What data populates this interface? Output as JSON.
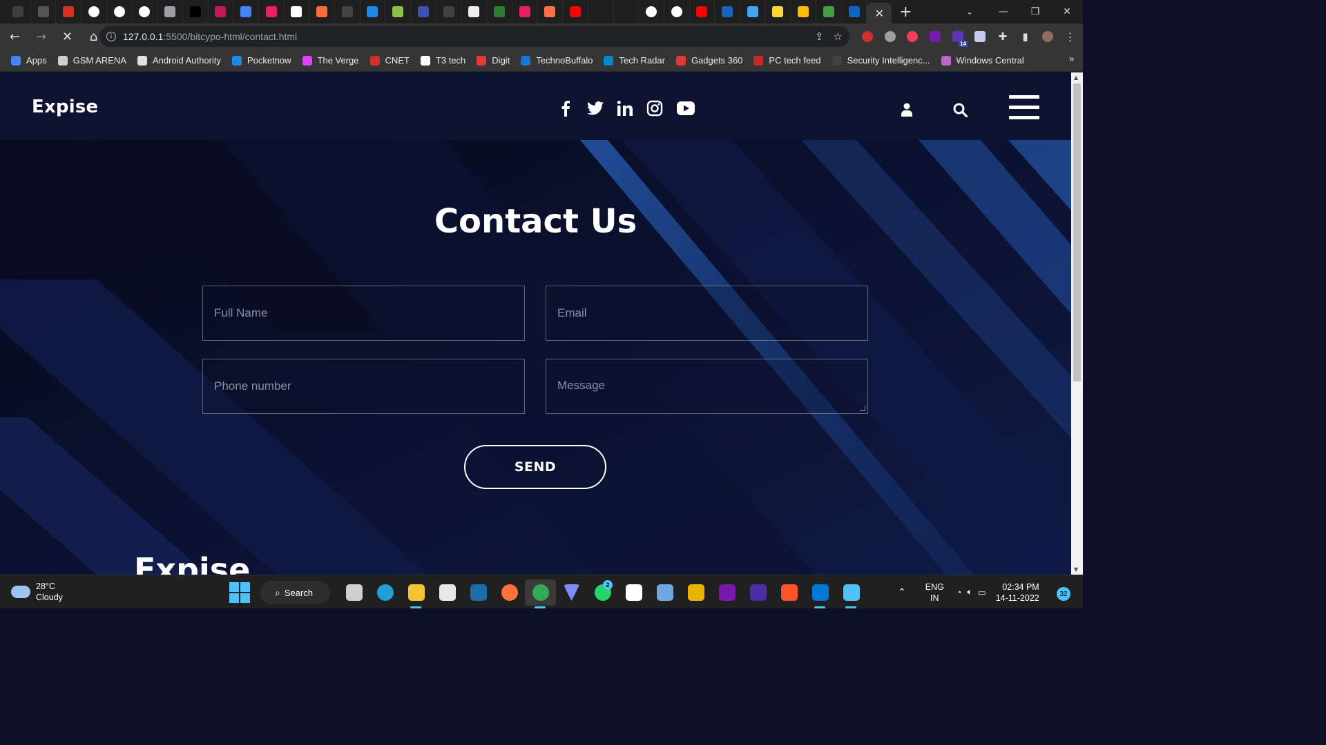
{
  "browser": {
    "tab_favicons": [
      {
        "name": "tab-1",
        "color": "#3c4043"
      },
      {
        "name": "tab-2",
        "color": "#555"
      },
      {
        "name": "gmail",
        "color": "#d93025"
      },
      {
        "name": "github",
        "color": "#ffffff"
      },
      {
        "name": "github",
        "color": "#ffffff"
      },
      {
        "name": "github",
        "color": "#ffffff"
      },
      {
        "name": "globe",
        "color": "#9aa0a6"
      },
      {
        "name": "medium",
        "color": "#000000"
      },
      {
        "name": "shield",
        "color": "#c2185b"
      },
      {
        "name": "map-pin",
        "color": "#4285f4"
      },
      {
        "name": "pattern",
        "color": "#e91e63"
      },
      {
        "name": "bolt",
        "color": "#ffffff"
      },
      {
        "name": "postman",
        "color": "#ff6c37"
      },
      {
        "name": "dot",
        "color": "#444"
      },
      {
        "name": "robot",
        "color": "#1e88e5"
      },
      {
        "name": "swirl",
        "color": "#8bc34a"
      },
      {
        "name": "sphere",
        "color": "#3f51b5"
      },
      {
        "name": "terminal",
        "color": "#424242"
      },
      {
        "name": "news",
        "color": "#eeeeee"
      },
      {
        "name": "j-logo",
        "color": "#2e7d32"
      },
      {
        "name": "pink-p",
        "color": "#e91e63"
      },
      {
        "name": "gradient",
        "color": "#ff7043"
      },
      {
        "name": "youtube",
        "color": "#ff0000"
      },
      {
        "name": "blank",
        "color": "#1f1f1f"
      },
      {
        "name": "blank-2",
        "color": "#1f1f1f"
      },
      {
        "name": "github",
        "color": "#ffffff"
      },
      {
        "name": "github",
        "color": "#ffffff"
      },
      {
        "name": "youtube",
        "color": "#ff0000"
      },
      {
        "name": "cloud",
        "color": "#1565c0"
      },
      {
        "name": "bars",
        "color": "#42a5f5"
      },
      {
        "name": "yellow-doc",
        "color": "#fdd835"
      },
      {
        "name": "drive",
        "color": "#fbbc04"
      },
      {
        "name": "green-shield",
        "color": "#43a047"
      },
      {
        "name": "linkedin",
        "color": "#0a66c2"
      }
    ],
    "address_host": "127.0.0.1",
    "address_path": ":5500/bitcypo-html/contact.html",
    "bookmarks": [
      {
        "label": "Apps",
        "color": "#4285f4"
      },
      {
        "label": "GSM ARENA",
        "color": "#d0d0d0"
      },
      {
        "label": "Android Authority",
        "color": "#e0e0e0"
      },
      {
        "label": "Pocketnow",
        "color": "#1e88e5"
      },
      {
        "label": "The Verge",
        "color": "#e040fb"
      },
      {
        "label": "CNET",
        "color": "#d32f2f"
      },
      {
        "label": "T3 tech",
        "color": "#ffffff"
      },
      {
        "label": "Digit",
        "color": "#e53935"
      },
      {
        "label": "TechnoBuffalo",
        "color": "#1976d2"
      },
      {
        "label": "Tech Radar",
        "color": "#0288d1"
      },
      {
        "label": "Gadgets 360",
        "color": "#e53935"
      },
      {
        "label": "PC tech feed",
        "color": "#c62828"
      },
      {
        "label": "Security Intelligenc...",
        "color": "#424242"
      },
      {
        "label": "Windows Central",
        "color": "#ba68c8"
      }
    ]
  },
  "site": {
    "logo": "Expise",
    "title": "Contact Us",
    "form": {
      "full_name_placeholder": "Full Name",
      "email_placeholder": "Email",
      "phone_placeholder": "Phone number",
      "message_placeholder": "Message",
      "send_label": "SEND"
    },
    "footer_brand": "Expise",
    "social_icons": [
      "facebook-icon",
      "twitter-icon",
      "linkedin-icon",
      "instagram-icon",
      "youtube-icon"
    ]
  },
  "taskbar": {
    "temperature": "28°C",
    "condition": "Cloudy",
    "search_label": "Search",
    "language": "ENG",
    "region": "IN",
    "time": "02:34 PM",
    "date": "14-11-2022",
    "notification_count": "32",
    "whatsapp_badge": "2",
    "extension_badge": "14"
  },
  "colors": {
    "page_bg": "#0b0f25",
    "header_bg": "#0e1231",
    "accent_stripe": "#1f4f9c"
  }
}
